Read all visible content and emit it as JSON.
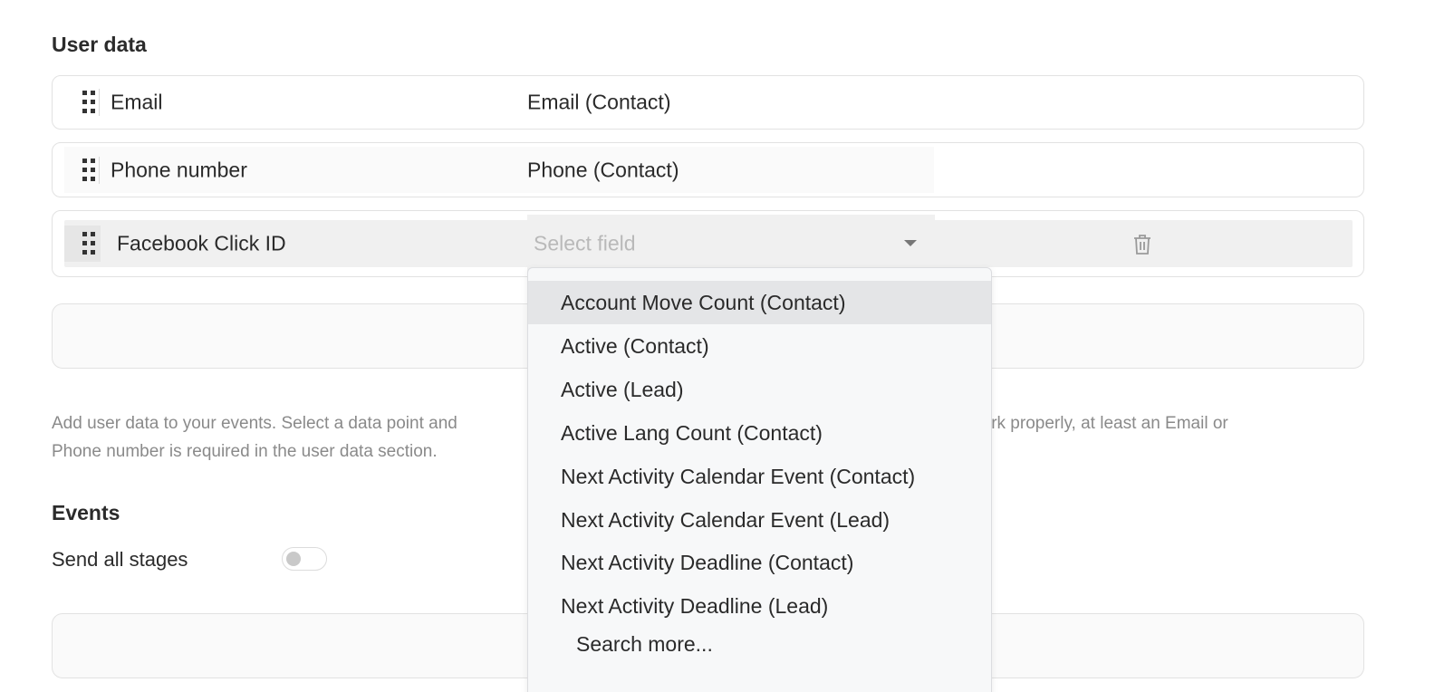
{
  "user_data": {
    "title": "User data",
    "rows": [
      {
        "label": "Email",
        "value": "Email (Contact)"
      },
      {
        "label": "Phone number",
        "value": "Phone (Contact)"
      },
      {
        "label": "Facebook Click ID",
        "placeholder": "Select field"
      }
    ],
    "helper_text": "Add user data to your events. Select a data point and ... ts work properly, at least an Email or Phone number is required in the user data section.",
    "helper_left": "Add user data to your events. Select a data point and",
    "helper_right": "ts work properly, at least an Email or",
    "helper_line2": "Phone number is required in the user data section."
  },
  "events": {
    "title": "Events",
    "send_all_label": "Send all stages",
    "send_all_enabled": false
  },
  "dropdown": {
    "options": [
      "Account Move Count (Contact)",
      "Active (Contact)",
      "Active (Lead)",
      "Active Lang Count (Contact)",
      "Next Activity Calendar Event (Contact)",
      "Next Activity Calendar Event (Lead)",
      "Next Activity Deadline (Contact)",
      "Next Activity Deadline (Lead)"
    ],
    "highlighted_index": 0,
    "search_more": "Search more..."
  },
  "icons": {
    "drag": "drag-handle-icon",
    "caret": "caret-down-icon",
    "delete": "trash-icon"
  },
  "colors": {
    "border": "#e2e2e2",
    "highlight": "#e4e5e7",
    "muted_text": "#8a8a8a"
  }
}
